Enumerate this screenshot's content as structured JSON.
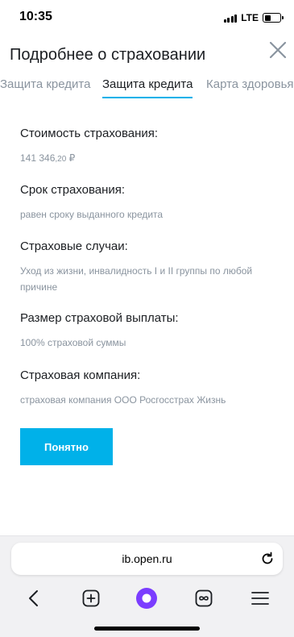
{
  "status_bar": {
    "time": "10:35",
    "network": "LTE",
    "battery_level": 0.4
  },
  "header": {
    "title": "Подробнее о страховании",
    "close_icon": "close-icon"
  },
  "tabs": [
    {
      "label": "Защита кредита",
      "active": false
    },
    {
      "label": "Защита кредита",
      "active": true
    },
    {
      "label": "Карта здоровья",
      "active": false
    }
  ],
  "sections": {
    "cost": {
      "label": "Стоимость страхования:",
      "value_integer": "141 346",
      "value_fraction": ",20",
      "value_currency": " ₽"
    },
    "term": {
      "label": "Срок страхования:",
      "value": "равен сроку выданного кредита"
    },
    "cases": {
      "label": "Страховые случаи:",
      "value": "Уход из жизни, инвалидность I и II группы по любой причине"
    },
    "payout": {
      "label": "Размер страховой выплаты:",
      "value": "100% страховой суммы"
    },
    "company": {
      "label": "Страховая компания:",
      "value": "страховая компания ООО Росгосстрах Жизнь"
    }
  },
  "ok_button": {
    "label": "Понятно"
  },
  "browser": {
    "url": "ib.open.ru",
    "reload_icon": "reload-icon",
    "nav_icons": [
      "back-icon",
      "new-tab-icon",
      "alice-icon",
      "tabs-icon",
      "menu-icon"
    ]
  },
  "colors": {
    "accent": "#00b1e9",
    "alice": "#7b3dff",
    "text_primary": "#1b1e22",
    "text_secondary": "#8a949f"
  }
}
